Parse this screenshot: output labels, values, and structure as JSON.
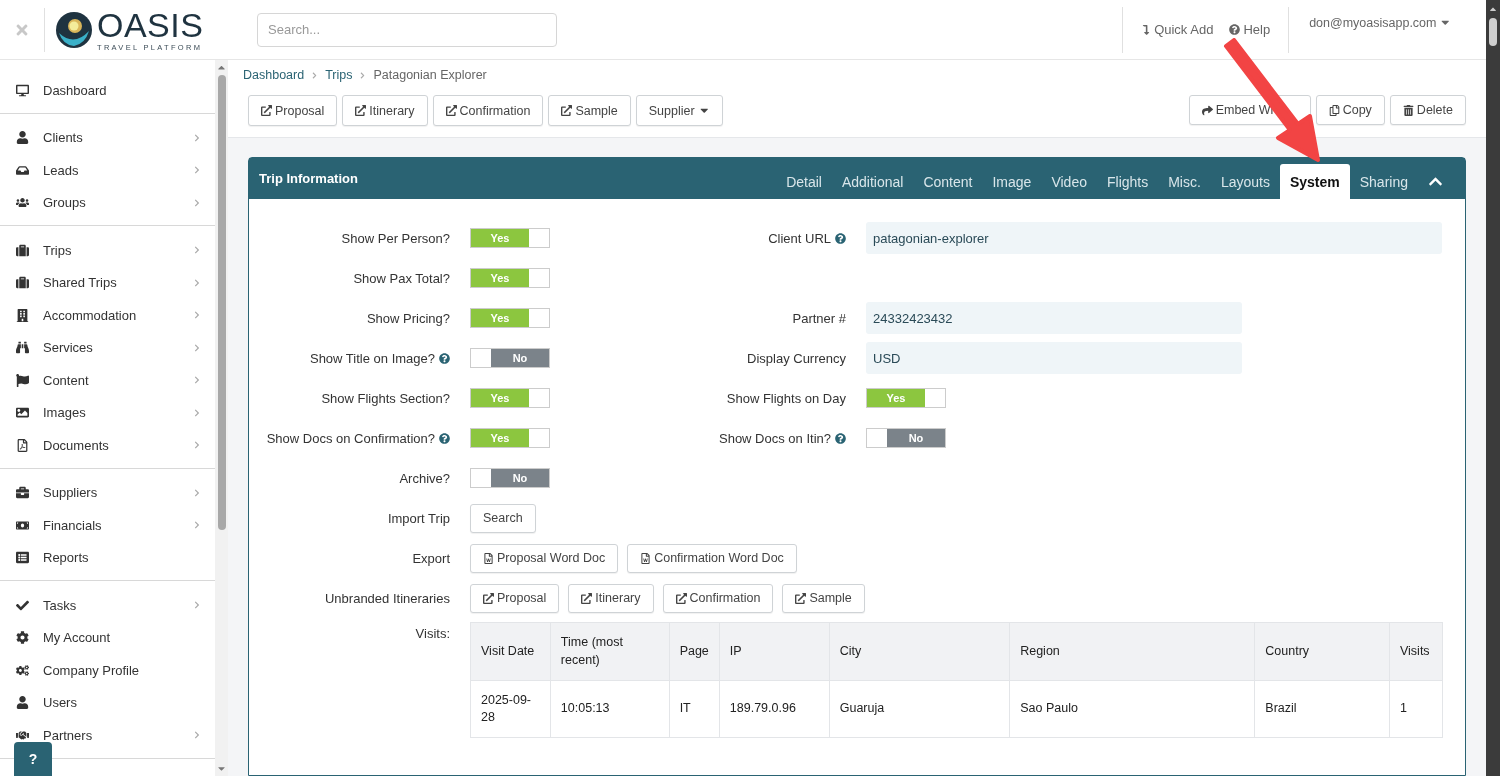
{
  "topbar": {
    "logo": {
      "name": "OASIS",
      "tagline": "TRAVEL PLATFORM"
    },
    "search": {
      "placeholder": "Search..."
    },
    "actions": [
      {
        "label": "Quick Add"
      },
      {
        "label": "Help"
      }
    ],
    "user": "don@myoasisapp.com"
  },
  "sidebar": {
    "groups": [
      {
        "items": [
          {
            "label": "Dashboard",
            "has_submenu": false
          }
        ]
      },
      {
        "items": [
          {
            "label": "Clients",
            "has_submenu": true
          },
          {
            "label": "Leads",
            "has_submenu": true
          },
          {
            "label": "Groups",
            "has_submenu": true
          }
        ]
      },
      {
        "items": [
          {
            "label": "Trips",
            "has_submenu": true
          },
          {
            "label": "Shared Trips",
            "has_submenu": true
          },
          {
            "label": "Accommodation",
            "has_submenu": true
          },
          {
            "label": "Services",
            "has_submenu": true
          },
          {
            "label": "Content",
            "has_submenu": true
          },
          {
            "label": "Images",
            "has_submenu": true
          },
          {
            "label": "Documents",
            "has_submenu": true
          }
        ]
      },
      {
        "items": [
          {
            "label": "Suppliers",
            "has_submenu": true
          },
          {
            "label": "Financials",
            "has_submenu": true
          },
          {
            "label": "Reports",
            "has_submenu": false
          }
        ]
      },
      {
        "items": [
          {
            "label": "Tasks",
            "has_submenu": true
          },
          {
            "label": "My Account",
            "has_submenu": false
          },
          {
            "label": "Company Profile",
            "has_submenu": false
          },
          {
            "label": "Users",
            "has_submenu": false
          },
          {
            "label": "Partners",
            "has_submenu": true
          }
        ]
      }
    ]
  },
  "help_button": "?",
  "breadcrumb": [
    {
      "label": "Dashboard",
      "link": true
    },
    {
      "label": "Trips",
      "link": true
    },
    {
      "label": "Patagonian Explorer",
      "link": false
    }
  ],
  "toolbar": {
    "left": [
      {
        "label": "Proposal",
        "kind": "link"
      },
      {
        "label": "Itinerary",
        "kind": "link"
      },
      {
        "label": "Confirmation",
        "kind": "link"
      },
      {
        "label": "Sample",
        "kind": "link"
      },
      {
        "label": "Supplier",
        "kind": "dropdown"
      }
    ],
    "right": [
      {
        "label": "Embed Wi",
        "kind": "share"
      },
      {
        "label": "Copy",
        "kind": "copy"
      },
      {
        "label": "Delete",
        "kind": "delete"
      }
    ]
  },
  "panel": {
    "title": "Trip Information",
    "tabs": [
      {
        "label": "Detail",
        "selected": false
      },
      {
        "label": "Additional",
        "selected": false
      },
      {
        "label": "Content",
        "selected": false
      },
      {
        "label": "Image",
        "selected": false
      },
      {
        "label": "Video",
        "selected": false
      },
      {
        "label": "Flights",
        "selected": false
      },
      {
        "label": "Misc.",
        "selected": false
      },
      {
        "label": "Layouts",
        "selected": false
      },
      {
        "label": "System",
        "selected": true
      },
      {
        "label": "Sharing",
        "selected": false
      }
    ],
    "rows": [
      {
        "left": {
          "label": "Show Per Person?",
          "help": false,
          "kind": "toggle",
          "on": true,
          "text": "Yes"
        },
        "right": {
          "label": "Client URL",
          "help": true,
          "kind": "input",
          "value": "patagonian-explorer"
        }
      },
      {
        "left": {
          "label": "Show Pax Total?",
          "help": false,
          "kind": "toggle",
          "on": true,
          "text": "Yes"
        }
      },
      {
        "left": {
          "label": "Show Pricing?",
          "help": false,
          "kind": "toggle",
          "on": true,
          "text": "Yes"
        },
        "right": {
          "label": "Partner #",
          "help": false,
          "kind": "input",
          "value": "24332423432"
        }
      },
      {
        "left": {
          "label": "Show Title on Image?",
          "help": true,
          "kind": "toggle",
          "on": false,
          "text": "No"
        },
        "right": {
          "label": "Display Currency",
          "help": false,
          "kind": "input",
          "value": "USD"
        }
      },
      {
        "left": {
          "label": "Show Flights Section?",
          "help": false,
          "kind": "toggle",
          "on": true,
          "text": "Yes"
        },
        "right": {
          "label": "Show Flights on Day",
          "help": false,
          "kind": "toggle",
          "on": true,
          "text": "Yes"
        }
      },
      {
        "left": {
          "label": "Show Docs on Confirmation?",
          "help": true,
          "kind": "toggle",
          "on": true,
          "text": "Yes"
        },
        "right": {
          "label": "Show Docs on Itin?",
          "help": true,
          "kind": "toggle",
          "on": false,
          "text": "No"
        }
      },
      {
        "left": {
          "label": "Archive?",
          "help": false,
          "kind": "toggle",
          "on": false,
          "text": "No"
        }
      },
      {
        "left": {
          "label": "Import Trip",
          "help": false,
          "kind": "buttons",
          "buttons": [
            {
              "label": "Search",
              "kind": "plain"
            }
          ]
        }
      },
      {
        "left": {
          "label": "Export",
          "help": false,
          "kind": "buttons",
          "buttons": [
            {
              "label": "Proposal Word Doc",
              "kind": "word"
            },
            {
              "label": "Confirmation Word Doc",
              "kind": "word"
            }
          ]
        }
      },
      {
        "left": {
          "label": "Unbranded Itineraries",
          "help": false,
          "kind": "buttons",
          "buttons": [
            {
              "label": "Proposal",
              "kind": "link"
            },
            {
              "label": "Itinerary",
              "kind": "link"
            },
            {
              "label": "Confirmation",
              "kind": "link"
            },
            {
              "label": "Sample",
              "kind": "link"
            }
          ]
        }
      }
    ],
    "visits": {
      "label": "Visits:",
      "columns": [
        "Visit Date",
        "Time (most recent)",
        "Page",
        "IP",
        "City",
        "Region",
        "Country",
        "Visits"
      ],
      "rows": [
        [
          "2025-09-28",
          "10:05:13",
          "IT",
          "189.79.0.96",
          "Guaruja",
          "Sao Paulo",
          "Brazil",
          "1"
        ]
      ]
    }
  }
}
